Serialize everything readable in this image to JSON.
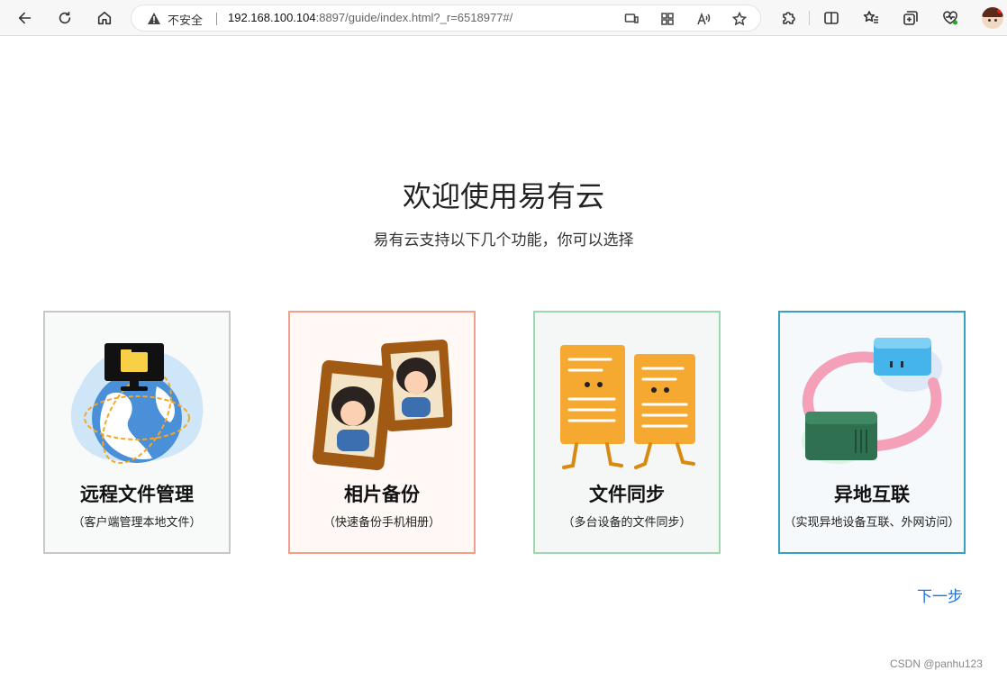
{
  "browser": {
    "security_label": "不安全",
    "url_host": "192.168.100.104",
    "url_rest": ":8897/guide/index.html?_r=6518977#/",
    "icons": {
      "back": "back-arrow-icon",
      "refresh": "refresh-icon",
      "home": "home-icon",
      "warning": "warning-icon",
      "cast": "cast-icon",
      "apps": "apps-grid-icon",
      "read_aloud": "read-aloud-icon",
      "favorite": "star-icon",
      "extensions": "puzzle-icon",
      "split_screen": "split-screen-icon",
      "favorites_bar": "favorites-icon",
      "collections": "collections-icon",
      "performance": "heart-pulse-icon",
      "profile": "profile-avatar"
    }
  },
  "main": {
    "title": "欢迎使用易有云",
    "subtitle": "易有云支持以下几个功能，你可以选择",
    "cards": [
      {
        "title": "远程文件管理",
        "desc": "（客户端管理本地文件）",
        "border": "#c8c8c8",
        "bg": "#f8faf9"
      },
      {
        "title": "相片备份",
        "desc": "（快速备份手机相册）",
        "border": "#f0a08a",
        "bg": "#fff8f5"
      },
      {
        "title": "文件同步",
        "desc": "（多台设备的文件同步）",
        "border": "#9fd8b0",
        "bg": "#f5f7f6"
      },
      {
        "title": "异地互联",
        "desc": "（实现异地设备互联、外网访问）",
        "border": "#3a9ec0",
        "bg": "#f5f9fc"
      }
    ],
    "next_label": "下一步"
  },
  "watermark": "CSDN @panhu123"
}
